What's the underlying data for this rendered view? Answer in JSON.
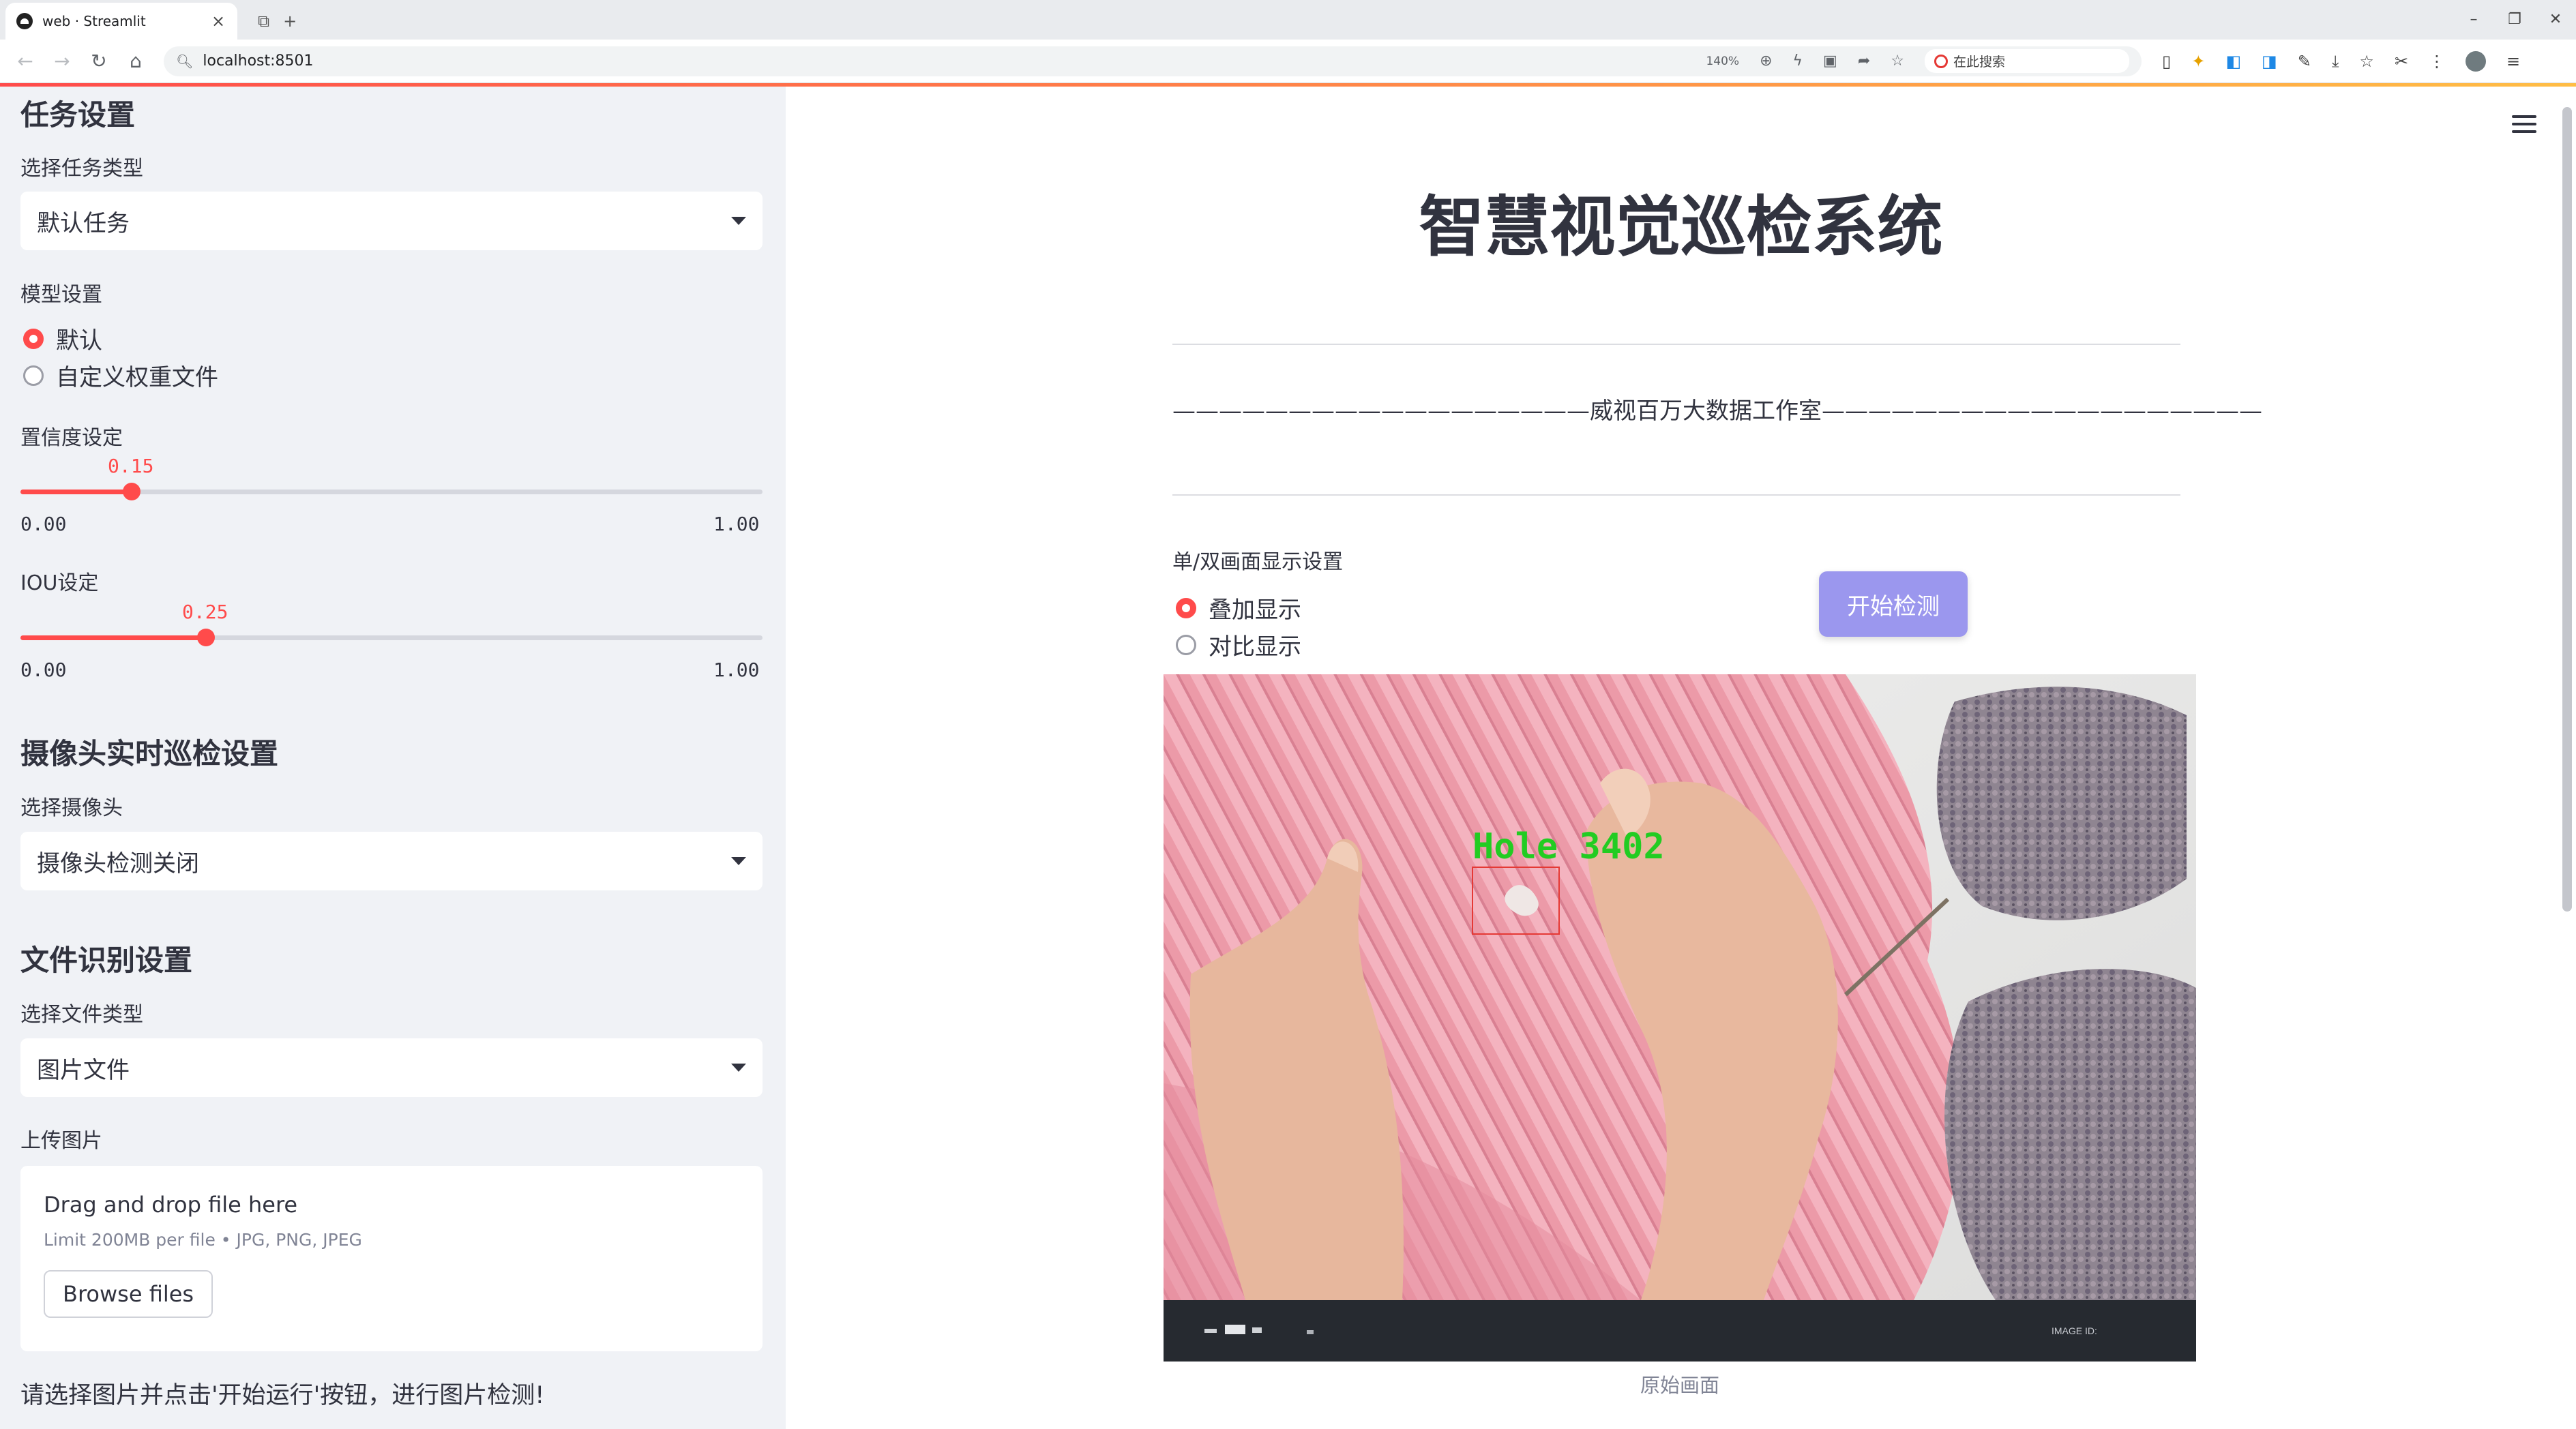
{
  "browser": {
    "tab_title": "web · Streamlit",
    "url": "localhost:8501",
    "zoom": "140%",
    "search_placeholder": "在此搜索"
  },
  "sidebar": {
    "task_header": "任务设置",
    "task_type_label": "选择任务类型",
    "task_type_value": "默认任务",
    "model_label": "模型设置",
    "model_options": [
      "默认",
      "自定义权重文件"
    ],
    "model_selected": 0,
    "confidence": {
      "label": "置信度设定",
      "value": "0.15",
      "min": "0.00",
      "max": "1.00",
      "fraction": 0.15
    },
    "iou": {
      "label": "IOU设定",
      "value": "0.25",
      "min": "0.00",
      "max": "1.00",
      "fraction": 0.25
    },
    "camera_header": "摄像头实时巡检设置",
    "camera_label": "选择摄像头",
    "camera_value": "摄像头检测关闭",
    "file_header": "文件识别设置",
    "file_type_label": "选择文件类型",
    "file_type_value": "图片文件",
    "upload_label": "上传图片",
    "uploader": {
      "title": "Drag and drop file here",
      "limit": "Limit 200MB per file • JPG, PNG, JPEG",
      "button": "Browse files"
    },
    "info_text": "请选择图片并点击'开始运行'按钮，进行图片检测!"
  },
  "main": {
    "title": "智慧视觉巡检系统",
    "subtitle": "——————————————————威视百万大数据工作室———————————————————",
    "display_label": "单/双画面显示设置",
    "display_options": [
      "叠加显示",
      "对比显示"
    ],
    "display_selected": 0,
    "start_button": "开始检测",
    "detection_label": "Hole  3402",
    "image_footer_text": "IMAGE ID:",
    "caption": "原始画面"
  },
  "colors": {
    "accent": "#ff4b4b",
    "button": "#9b97ee",
    "sidebar_bg": "#f0f2f6",
    "detection_text": "#22cc22",
    "detection_box": "#e53935"
  }
}
